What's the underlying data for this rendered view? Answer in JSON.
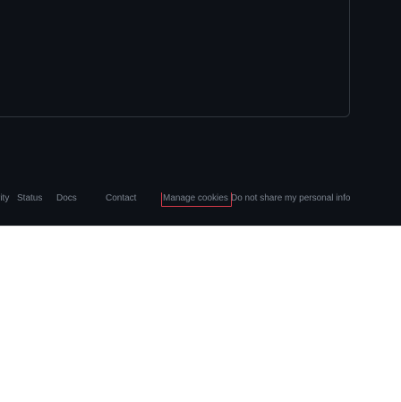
{
  "footer": {
    "links": [
      "rity",
      "Status",
      "Docs",
      "Contact",
      "Manage cookies",
      "Do not share my personal info"
    ]
  },
  "colors": {
    "background": "#0d1117",
    "border": "#30363d",
    "link": "#7d8590",
    "focus_outline": "#d73a49",
    "overlay": "#ffffff"
  }
}
